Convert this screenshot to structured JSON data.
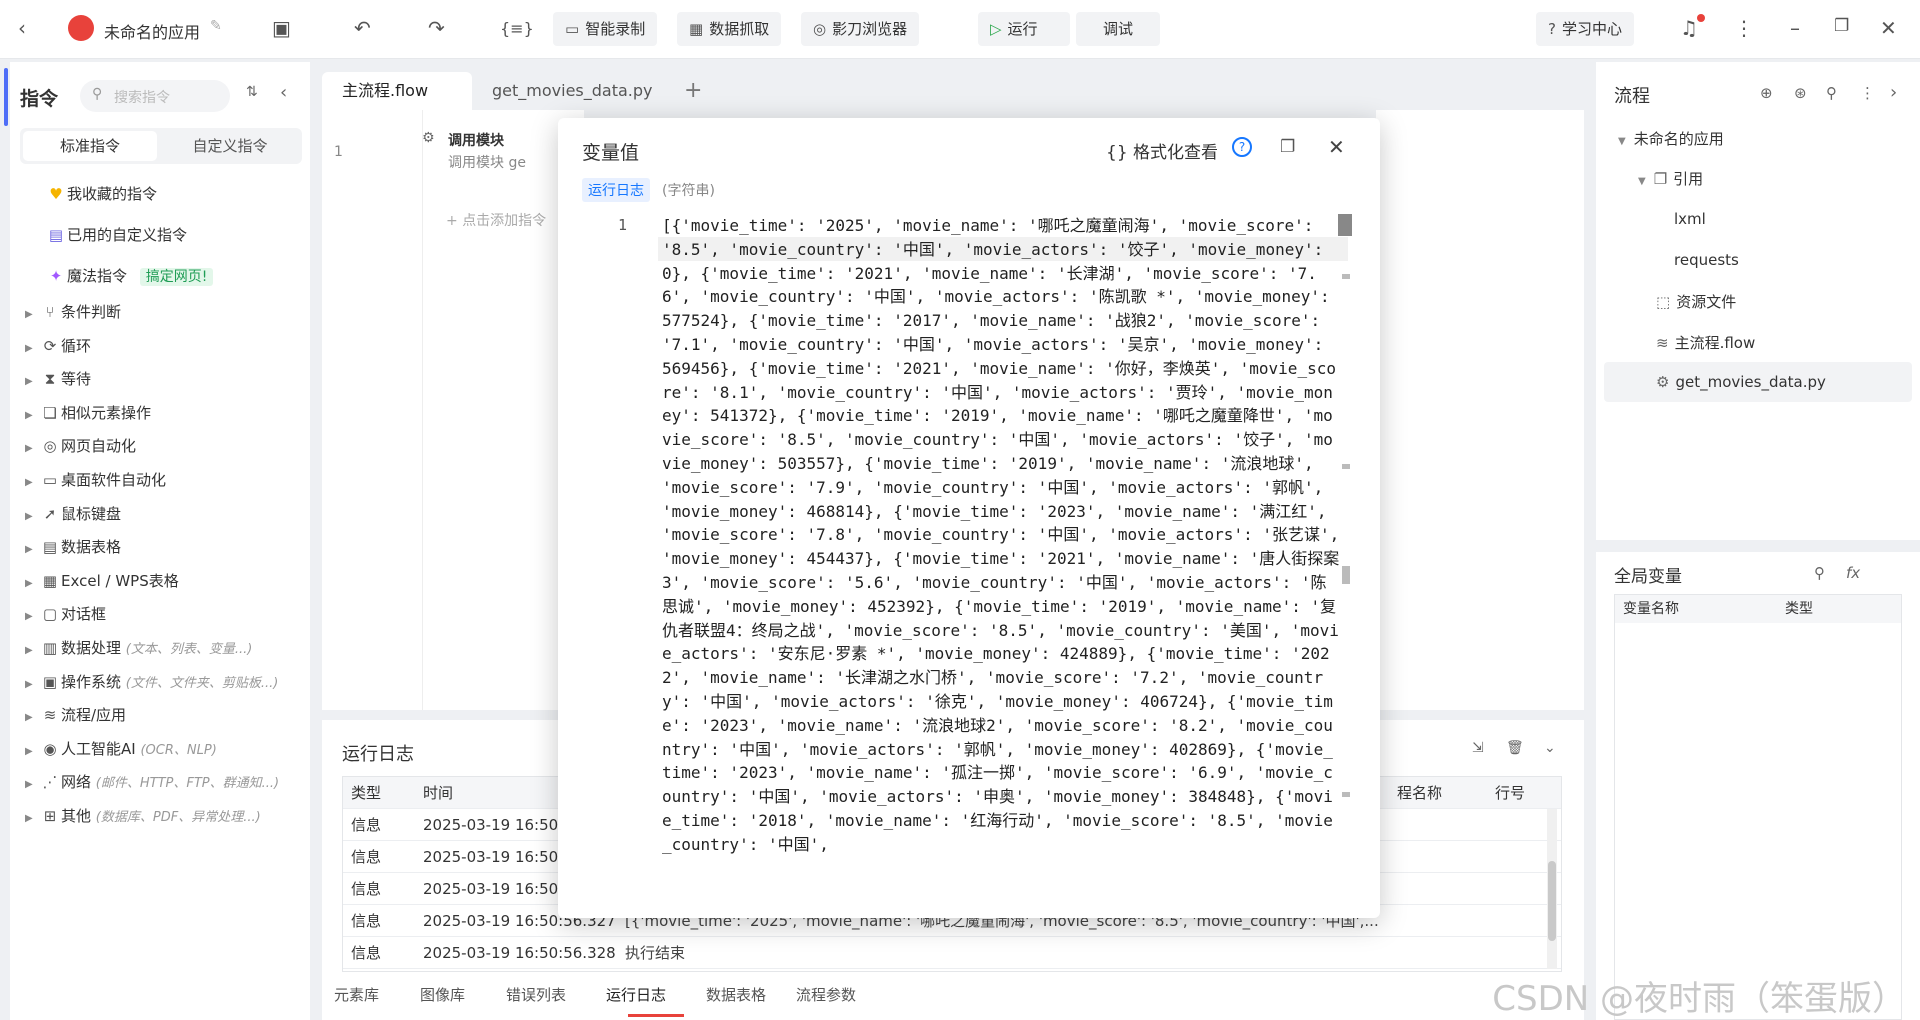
{
  "app": {
    "title": "未命名的应用"
  },
  "toolbar": {
    "smart_record": "智能录制",
    "data_capture": "数据抓取",
    "browser": "影刀浏览器",
    "run": "运行",
    "debug": "调试",
    "learn": "学习中心"
  },
  "left": {
    "title": "指令",
    "search_placeholder": "搜索指令",
    "tab_standard": "标准指令",
    "tab_custom": "自定义指令",
    "favorites": "我收藏的指令",
    "used_custom": "已用的自定义指令",
    "magic": "魔法指令",
    "magic_badge": "搞定网页!",
    "items": [
      {
        "label": "条件判断",
        "hint": ""
      },
      {
        "label": "循环",
        "hint": ""
      },
      {
        "label": "等待",
        "hint": ""
      },
      {
        "label": "相似元素操作",
        "hint": ""
      },
      {
        "label": "网页自动化",
        "hint": ""
      },
      {
        "label": "桌面软件自动化",
        "hint": ""
      },
      {
        "label": "鼠标键盘",
        "hint": ""
      },
      {
        "label": "数据表格",
        "hint": ""
      },
      {
        "label": "Excel / WPS表格",
        "hint": ""
      },
      {
        "label": "对话框",
        "hint": ""
      },
      {
        "label": "数据处理",
        "hint": "(文本、列表、变量...)"
      },
      {
        "label": "操作系统",
        "hint": "(文件、文件夹、剪贴板...)"
      },
      {
        "label": "流程/应用",
        "hint": ""
      },
      {
        "label": "人工智能AI",
        "hint": "(OCR、NLP)"
      },
      {
        "label": "网络",
        "hint": "(邮件、HTTP、FTP、群通知...)"
      },
      {
        "label": "其他",
        "hint": "(数据库、PDF、异常处理...)"
      }
    ]
  },
  "tabs": {
    "main_flow": "主流程.flow",
    "py": "get_movies_data.py"
  },
  "editor": {
    "line_no": "1",
    "step_title": "调用模块",
    "step_desc": "调用模块 ge",
    "add_hint": "点击添加指令"
  },
  "dialog": {
    "title": "变量值",
    "format_view": "格式化查看",
    "tag": "运行日志",
    "type": "(字符串)",
    "line_no": "1",
    "value": "[{'movie_time': '2025', 'movie_name': '哪吒之魔童闹海', 'movie_score': '8.5', 'movie_country': '中国', 'movie_actors': '饺子', 'movie_money': 0}, {'movie_time': '2021', 'movie_name': '长津湖', 'movie_score': '7.6', 'movie_country': '中国', 'movie_actors': '陈凯歌 *', 'movie_money': 577524}, {'movie_time': '2017', 'movie_name': '战狼2', 'movie_score': '7.1', 'movie_country': '中国', 'movie_actors': '吴京', 'movie_money': 569456}, {'movie_time': '2021', 'movie_name': '你好，李焕英', 'movie_score': '8.1', 'movie_country': '中国', 'movie_actors': '贾玲', 'movie_money': 541372}, {'movie_time': '2019', 'movie_name': '哪吒之魔童降世', 'movie_score': '8.5', 'movie_country': '中国', 'movie_actors': '饺子', 'movie_money': 503557}, {'movie_time': '2019', 'movie_name': '流浪地球', 'movie_score': '7.9', 'movie_country': '中国', 'movie_actors': '郭帆', 'movie_money': 468814}, {'movie_time': '2023', 'movie_name': '满江红', 'movie_score': '7.8', 'movie_country': '中国', 'movie_actors': '张艺谋', 'movie_money': 454437}, {'movie_time': '2021', 'movie_name': '唐人街探案3', 'movie_score': '5.6', 'movie_country': '中国', 'movie_actors': '陈思诚', 'movie_money': 452392}, {'movie_time': '2019', 'movie_name': '复仇者联盟4：终局之战', 'movie_score': '8.5', 'movie_country': '美国', 'movie_actors': '安东尼·罗素 *', 'movie_money': 424889}, {'movie_time': '2022', 'movie_name': '长津湖之水门桥', 'movie_score': '7.2', 'movie_country': '中国', 'movie_actors': '徐克', 'movie_money': 406724}, {'movie_time': '2023', 'movie_name': '流浪地球2', 'movie_score': '8.2', 'movie_country': '中国', 'movie_actors': '郭帆', 'movie_money': 402869}, {'movie_time': '2023', 'movie_name': '孤注一掷', 'movie_score': '6.9', 'movie_country': '中国', 'movie_actors': '申奥', 'movie_money': 384848}, {'movie_time': '2018', 'movie_name': '红海行动', 'movie_score': '8.5', 'movie_country': '中国',"
  },
  "log": {
    "title": "运行日志",
    "headers": {
      "type": "类型",
      "time": "时间",
      "process": "程名称",
      "line": "行号"
    },
    "rows": [
      {
        "type": "信息",
        "time": "2025-03-19 16:50:",
        "msg": ""
      },
      {
        "type": "信息",
        "time": "2025-03-19 16:50:",
        "msg": ""
      },
      {
        "type": "信息",
        "time": "2025-03-19 16:50:",
        "msg": ""
      },
      {
        "type": "信息",
        "time": "2025-03-19 16:50:56.327",
        "msg": "[{'movie_time': '2025', 'movie_name': '哪吒之魔童闹海', 'movie_score': '8.5', 'movie_country': '中国',..."
      },
      {
        "type": "信息",
        "time": "2025-03-19 16:50:56.328",
        "msg": "执行结束"
      }
    ],
    "bottom_tabs": [
      "元素库",
      "图像库",
      "错误列表",
      "运行日志",
      "数据表格",
      "流程参数"
    ]
  },
  "right": {
    "flow_title": "流程",
    "app_name": "未命名的应用",
    "ref": "引用",
    "lxml": "lxml",
    "requests": "requests",
    "resources": "资源文件",
    "main_flow": "主流程.flow",
    "py": "get_movies_data.py",
    "global_vars": "全局变量",
    "col_name": "变量名称",
    "col_type": "类型"
  },
  "watermark": "CSDN @夜时雨（笨蛋版）",
  "colors": {
    "accent": "#1677ff",
    "brand_red": "#e8423b",
    "magic_green": "#36b37e"
  }
}
